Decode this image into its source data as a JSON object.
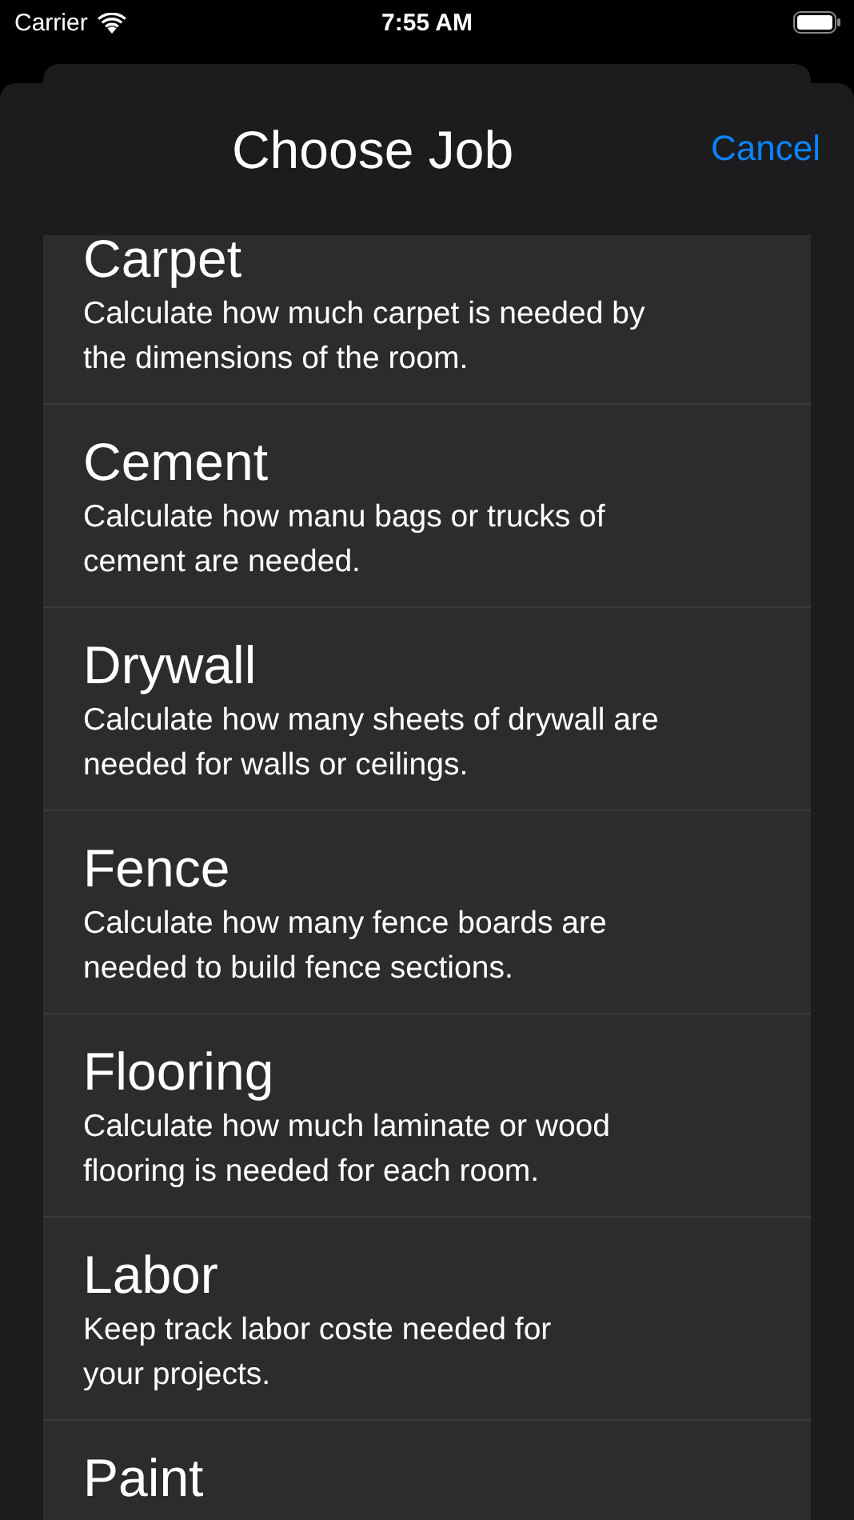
{
  "status_bar": {
    "carrier": "Carrier",
    "time": "7:55 AM"
  },
  "header": {
    "title": "Choose Job",
    "cancel": "Cancel"
  },
  "jobs": [
    {
      "title": "Carpet",
      "description": "Calculate how much carpet is needed by\nthe dimensions of the room."
    },
    {
      "title": "Cement",
      "description": "Calculate how manu bags or trucks of\ncement are needed."
    },
    {
      "title": "Drywall",
      "description": "Calculate how many sheets of drywall are\nneeded for walls or ceilings."
    },
    {
      "title": "Fence",
      "description": "Calculate how many fence boards are\nneeded to build fence sections."
    },
    {
      "title": "Flooring",
      "description": "Calculate how much laminate or wood\nflooring is needed for each room."
    },
    {
      "title": "Labor",
      "description": "Keep track labor coste needed for\nyour projects."
    },
    {
      "title": "Paint"
    }
  ]
}
